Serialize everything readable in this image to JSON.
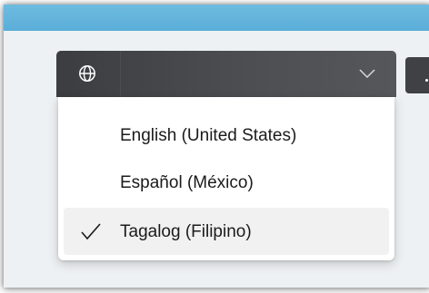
{
  "language_selector": {
    "icon": "globe-icon",
    "chevron": "chevron-down-icon",
    "options": [
      {
        "label": "English (United States)",
        "selected": false
      },
      {
        "label": "Español (México)",
        "selected": false
      },
      {
        "label": "Tagalog (Filipino)",
        "selected": true
      }
    ]
  },
  "colors": {
    "title_band": "#5aaed8",
    "selector_bg": "#3b3d40",
    "selected_option_bg": "#f1f1f1"
  }
}
